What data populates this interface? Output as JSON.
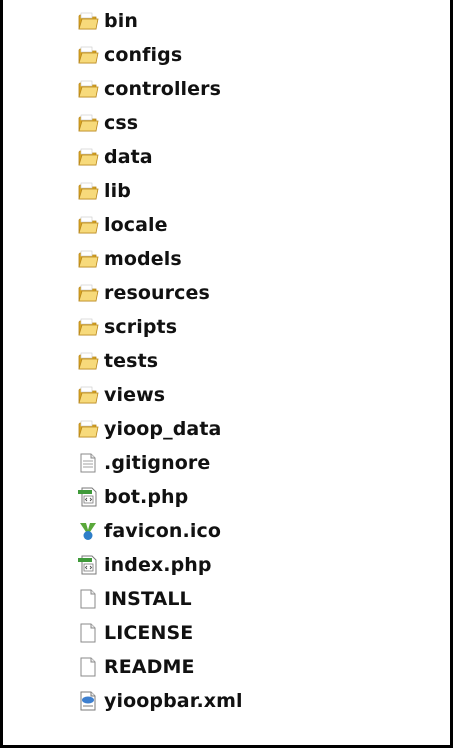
{
  "folders": [
    {
      "label": "bin",
      "icon": "folder-icon"
    },
    {
      "label": "configs",
      "icon": "folder-icon"
    },
    {
      "label": "controllers",
      "icon": "folder-icon"
    },
    {
      "label": "css",
      "icon": "folder-icon"
    },
    {
      "label": "data",
      "icon": "folder-icon"
    },
    {
      "label": "lib",
      "icon": "folder-icon"
    },
    {
      "label": "locale",
      "icon": "folder-icon"
    },
    {
      "label": "models",
      "icon": "folder-icon"
    },
    {
      "label": "resources",
      "icon": "folder-icon"
    },
    {
      "label": "scripts",
      "icon": "folder-icon"
    },
    {
      "label": "tests",
      "icon": "folder-icon"
    },
    {
      "label": "views",
      "icon": "folder-icon"
    },
    {
      "label": "yioop_data",
      "icon": "folder-icon"
    }
  ],
  "files": [
    {
      "label": ".gitignore",
      "icon": "text-file-icon"
    },
    {
      "label": "bot.php",
      "icon": "php-file-icon"
    },
    {
      "label": "favicon.ico",
      "icon": "yioop-favicon-icon"
    },
    {
      "label": "index.php",
      "icon": "php-file-icon"
    },
    {
      "label": "INSTALL",
      "icon": "blank-file-icon"
    },
    {
      "label": "LICENSE",
      "icon": "blank-file-icon"
    },
    {
      "label": "README",
      "icon": "blank-file-icon"
    },
    {
      "label": "yioopbar.xml",
      "icon": "xml-file-icon"
    }
  ],
  "colors": {
    "folder_light": "#f7da7b",
    "folder_dark": "#d9a520",
    "folder_edge": "#b8861a",
    "php_green": "#3f9a3a",
    "favicon_green": "#5aa83a",
    "favicon_blue": "#2e7ec8",
    "xml_blue": "#3d7fcf",
    "text": "#111111",
    "border": "#000000"
  }
}
